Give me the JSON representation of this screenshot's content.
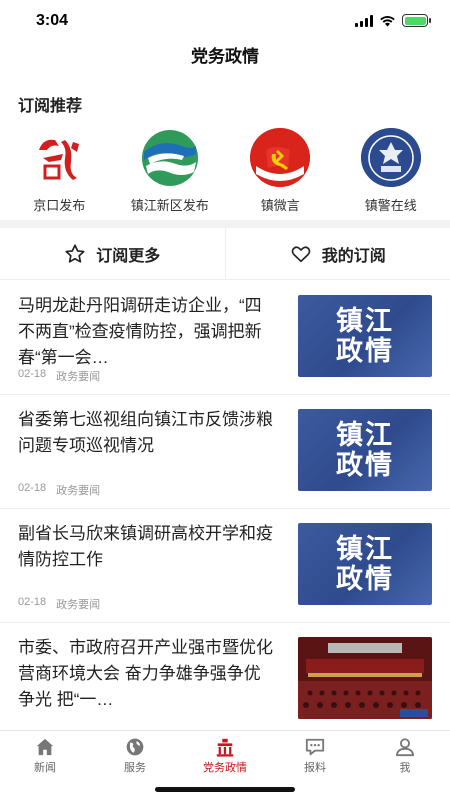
{
  "status": {
    "time": "3:04",
    "battery_level": 1.0
  },
  "nav": {
    "title": "党务政情"
  },
  "subscriptions": {
    "heading": "订阅推荐",
    "items": [
      {
        "label": "京口发布",
        "icon": "jingkou-logo"
      },
      {
        "label": "镇江新区发布",
        "icon": "xinqu-logo"
      },
      {
        "label": "镇微言",
        "icon": "party-emblem-logo"
      },
      {
        "label": "镇警在线",
        "icon": "police-badge-logo"
      }
    ]
  },
  "actions": {
    "more": "订阅更多",
    "mine": "我的订阅"
  },
  "news": [
    {
      "title": "马明龙赴丹阳调研走访企业，“四不两直”检查疫情防控，强调把新春“第一会…",
      "date": "02-18",
      "category": "政务要闻",
      "thumb_text": "镇江政情"
    },
    {
      "title": "省委第七巡视组向镇江市反馈涉粮问题专项巡视情况",
      "date": "02-18",
      "category": "政务要闻",
      "thumb_text": "镇江政情"
    },
    {
      "title": "副省长马欣来镇调研高校开学和疫情防控工作",
      "date": "02-18",
      "category": "政务要闻",
      "thumb_text": "镇江政情"
    },
    {
      "title": "市委、市政府召开产业强市暨优化营商环境大会 奋力争雄争强争优争光 把“一…",
      "date": "",
      "category": "",
      "thumb_text": ""
    }
  ],
  "tabs": [
    {
      "label": "新闻",
      "icon": "home-icon",
      "active": false
    },
    {
      "label": "服务",
      "icon": "globe-icon",
      "active": false
    },
    {
      "label": "党务政情",
      "icon": "building-icon",
      "active": true
    },
    {
      "label": "报料",
      "icon": "chat-icon",
      "active": false
    },
    {
      "label": "我",
      "icon": "user-icon",
      "active": false
    }
  ],
  "colors": {
    "accent": "#c8161d",
    "thumb_blue": "#3d5a9e"
  }
}
